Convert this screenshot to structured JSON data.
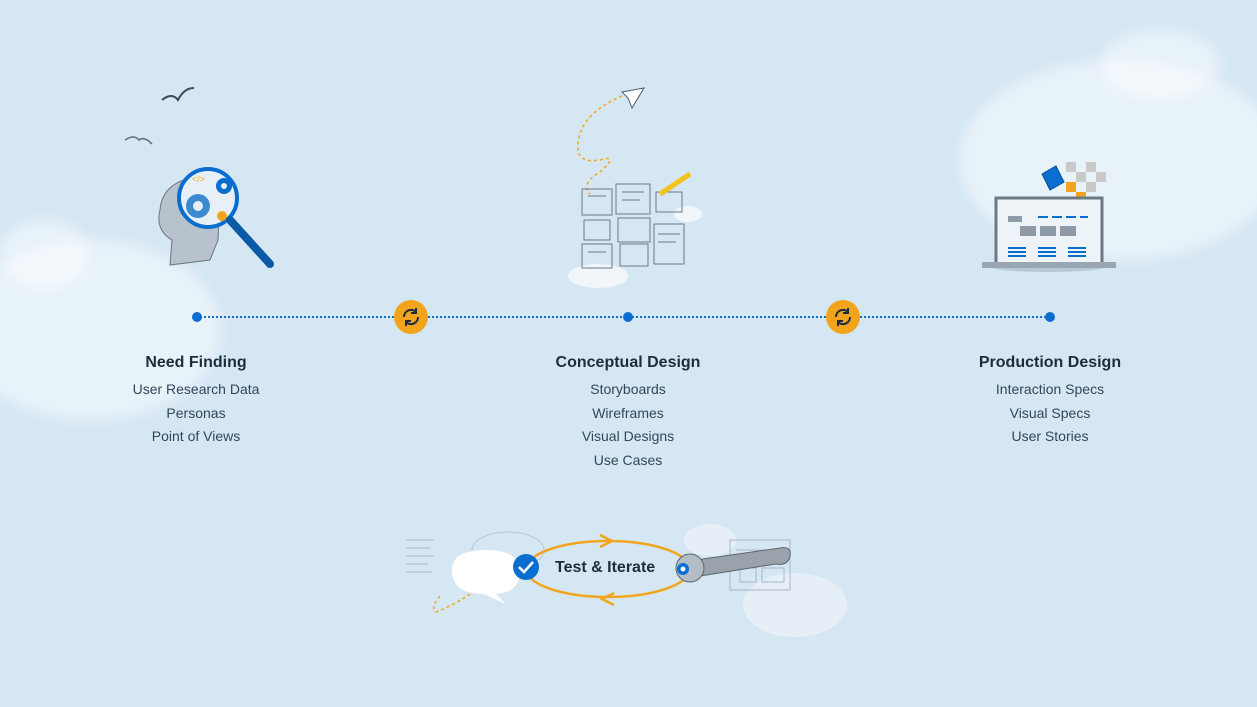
{
  "phases": [
    {
      "title": "Need Finding",
      "items": [
        "User Research Data",
        "Personas",
        "Point of Views"
      ]
    },
    {
      "title": "Conceptual Design",
      "items": [
        "Storyboards",
        "Wireframes",
        "Visual Designs",
        "Use Cases"
      ]
    },
    {
      "title": "Production Design",
      "items": [
        "Interaction Specs",
        "Visual Specs",
        "User Stories"
      ]
    }
  ],
  "test_iterate": {
    "label": "Test & Iterate"
  },
  "colors": {
    "background": "#d6e7f4",
    "accent_blue": "#0a6ed1",
    "accent_orange": "#f2a51c",
    "text": "#1d2d3e"
  },
  "icons": {
    "need_finding": "head-magnifier-icon",
    "conceptual_design": "sketch-paper-plane-icon",
    "production_design": "laptop-paint-icon",
    "cycle": "refresh-cycle-icon",
    "test": "chat-wrench-icon"
  }
}
